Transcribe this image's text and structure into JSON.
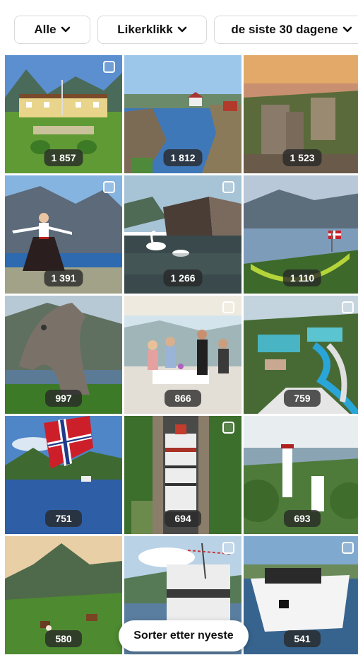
{
  "filters": {
    "type_label": "Alle",
    "metric_label": "Likerklikk",
    "period_label": "de siste 30 dagene"
  },
  "posts": [
    {
      "count": "1 857",
      "icon": "checkbox-icon"
    },
    {
      "count": "1 812",
      "icon": "checkbox-icon"
    },
    {
      "count": "1 523",
      "icon": "checkbox-icon"
    },
    {
      "count": "1 391",
      "icon": "checkbox-icon"
    },
    {
      "count": "1 266",
      "icon": "checkbox-icon"
    },
    {
      "count": "1 110",
      "icon": "checkbox-icon"
    },
    {
      "count": "997",
      "icon": "checkbox-icon"
    },
    {
      "count": "866",
      "icon": "checkbox-icon"
    },
    {
      "count": "759",
      "icon": "checkbox-icon"
    },
    {
      "count": "751",
      "icon": "checkbox-icon"
    },
    {
      "count": "694",
      "icon": "checkbox-icon"
    },
    {
      "count": "693",
      "icon": "checkbox-icon"
    },
    {
      "count": "580",
      "icon": "checkbox-icon"
    },
    {
      "count": "",
      "icon": "checkbox-icon"
    },
    {
      "count": "541",
      "icon": "checkbox-icon"
    }
  ],
  "sort_button_label": "Sorter etter nyeste"
}
